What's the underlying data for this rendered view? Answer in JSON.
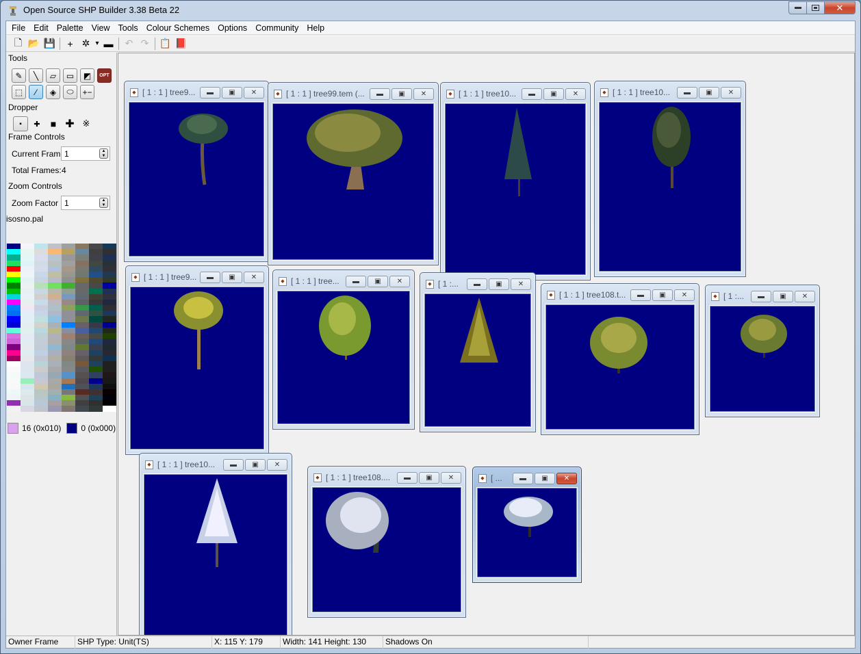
{
  "app": {
    "title": "Open Source SHP Builder 3.38 Beta 22",
    "window_buttons": [
      "minimize",
      "maximize",
      "close"
    ]
  },
  "menu": [
    "File",
    "Edit",
    "Palette",
    "View",
    "Tools",
    "Colour Schemes",
    "Options",
    "Community",
    "Help"
  ],
  "toolbar": [
    {
      "name": "new-file-icon",
      "glyph": "🗋",
      "enabled": true
    },
    {
      "name": "open-folder-icon",
      "glyph": "📂",
      "enabled": true
    },
    {
      "name": "save-icon",
      "glyph": "💾",
      "enabled": true
    },
    {
      "sep": true
    },
    {
      "name": "add-frame-icon",
      "glyph": "+",
      "enabled": true
    },
    {
      "name": "preview-icon",
      "glyph": "✲",
      "enabled": true
    },
    {
      "name": "dropdown-arrow-icon",
      "glyph": "▾",
      "enabled": true
    },
    {
      "name": "sequence-icon",
      "glyph": "▬",
      "enabled": true
    },
    {
      "sep": true
    },
    {
      "name": "undo-icon",
      "glyph": "↶",
      "enabled": false
    },
    {
      "name": "redo-icon",
      "glyph": "↷",
      "enabled": false
    },
    {
      "sep": true
    },
    {
      "name": "properties-icon",
      "glyph": "📋",
      "enabled": true
    },
    {
      "name": "help-book-icon",
      "glyph": "📕",
      "enabled": true
    }
  ],
  "left_panel": {
    "tools_label": "Tools",
    "tools": [
      {
        "name": "pencil-tool",
        "glyph": "✎",
        "active": false
      },
      {
        "name": "line-tool",
        "glyph": "╲",
        "active": false
      },
      {
        "name": "eraser-tool",
        "glyph": "▱",
        "active": false
      },
      {
        "name": "rectangle-tool",
        "glyph": "▭",
        "active": false
      },
      {
        "name": "darken-lighten-tool",
        "glyph": "◩",
        "active": false
      },
      {
        "name": "opt-tool",
        "glyph": "OPT",
        "active": false
      },
      {
        "name": "select-tool",
        "glyph": "⬚",
        "active": false
      },
      {
        "name": "dropper-tool",
        "glyph": "⁄",
        "active": true
      },
      {
        "name": "fill-tool",
        "glyph": "◈",
        "active": false
      },
      {
        "name": "ellipse-tool",
        "glyph": "⬭",
        "active": false
      },
      {
        "name": "brightness-tool",
        "glyph": "+−",
        "active": false
      }
    ],
    "dropper_label": "Dropper",
    "dropper_sizes": [
      {
        "name": "brush-size-1",
        "glyph": "▪",
        "active": true
      },
      {
        "name": "brush-size-2",
        "glyph": "✚",
        "active": false
      },
      {
        "name": "brush-size-3",
        "glyph": "■",
        "active": false
      },
      {
        "name": "brush-size-4",
        "glyph": "✚",
        "active": false
      },
      {
        "name": "brush-spray",
        "glyph": "※",
        "active": false
      }
    ],
    "frame_controls_label": "Frame Controls",
    "current_frame_label": "Current Frame",
    "current_frame_value": "1",
    "total_frames_label": "Total Frames:",
    "total_frames_value": "4",
    "zoom_controls_label": "Zoom Controls",
    "zoom_factor_label": "Zoom Factor",
    "zoom_factor_value": "1",
    "palette_name": "isosno.pal",
    "palette_columns": [
      [
        "#000080",
        "#00ffff",
        "#00b090",
        "#20e060",
        "#ff0000",
        "#ffff00",
        "#00ff00",
        "#008000",
        "#00c000",
        "#00d8d8",
        "#ff00ff",
        "#0080ff",
        "#0070f0",
        "#0000ff",
        "#0000d0",
        "#60ffd8",
        "#d870e0",
        "#d060d8",
        "#800080",
        "#ff0090",
        "#a00060",
        "#ffffff",
        "#fafafa",
        "#f4faf8",
        "#f6fafb",
        "#f8f8fa",
        "#eef8f8",
        "#f0f4f8",
        "#9030b0",
        "#f2f2f2"
      ],
      [
        "#f6f4f8",
        "#e8f6f0",
        "#e4f6f6",
        "#e0f4f8",
        "#eef2f8",
        "#eef4f8",
        "#e4f4f6",
        "#eef0f2",
        "#e8f0f4",
        "#eaf2f8",
        "#e8f0ee",
        "#f2e8f2",
        "#e4eef8",
        "#e2f0f6",
        "#e4eef0",
        "#e0f2ee",
        "#e6eaf4",
        "#e0eef4",
        "#e8eaee",
        "#dceef0",
        "#e6e8ec",
        "#e0e4ee",
        "#dce6ec",
        "#dce8f0",
        "#98f0b8",
        "#d8e4f0",
        "#dceaee",
        "#dce4e8",
        "#d8e6ea",
        "#d8d8e4"
      ],
      [
        "#c0e4ec",
        "#dcdcdc",
        "#d8dcec",
        "#d0dce4",
        "#d4dcec",
        "#c8d8e8",
        "#c8d4e0",
        "#b8e0b8",
        "#c8d8e0",
        "#d0d0d0",
        "#c8dce8",
        "#c8d0e0",
        "#c8d4e8",
        "#c0e0e0",
        "#d0d4cc",
        "#b8d8e0",
        "#c0d0d4",
        "#c4ccd8",
        "#c0ccd8",
        "#c0d0e4",
        "#c4c8d4",
        "#b8d4d8",
        "#cccccc",
        "#c0c8d8",
        "#c8c8d4",
        "#d0c8b0",
        "#b8c8c0",
        "#b8c8c8",
        "#b8c8d8",
        "#c0c4cc"
      ],
      [
        "#c0c0c8",
        "#f8b870",
        "#b8c4d0",
        "#b8c0c0",
        "#b0c0d8",
        "#c0c0a0",
        "#b8b8c8",
        "#70e060",
        "#b8b8a8",
        "#d0b090",
        "#c0b8c0",
        "#b0c0c8",
        "#b0b8c8",
        "#90c0e0",
        "#a8b0b8",
        "#b8b888",
        "#b0b0b8",
        "#b0b0b0",
        "#90b8d0",
        "#a8b0c0",
        "#b0b0a8",
        "#a8b0b8",
        "#a8a8a8",
        "#98a8b0",
        "#a8a8a8",
        "#a8a8a0",
        "#a0b0b0",
        "#88b0c0",
        "#a8a0a0",
        "#9898b0"
      ],
      [
        "#a0a0a0",
        "#b8a060",
        "#989898",
        "#a0a0a0",
        "#a89888",
        "#989890",
        "#909090",
        "#40b030",
        "#90a090",
        "#7898c0",
        "#988888",
        "#90a060",
        "#909098",
        "#909098",
        "#0080ff",
        "#8890a0",
        "#a08070",
        "#888888",
        "#808888",
        "#908080",
        "#888070",
        "#808888",
        "#888888",
        "#5890c8",
        "#a87850",
        "#2070c0",
        "#787878",
        "#88b840",
        "#889070",
        "#807870"
      ],
      [
        "#8a7860",
        "#6888a0",
        "#788078",
        "#887060",
        "#787870",
        "#707870",
        "#807040",
        "#686868",
        "#686868",
        "#606870",
        "#606068",
        "#389848",
        "#606870",
        "#707850",
        "#686068",
        "#4860a0",
        "#686058",
        "#586060",
        "#607830",
        "#686068",
        "#605858",
        "#785838",
        "#585860",
        "#585050",
        "#504850",
        "#505058",
        "#582a20",
        "#505050",
        "#404040",
        "#404850"
      ],
      [
        "#484848",
        "#404040",
        "#404048",
        "#404840",
        "#304860",
        "#20508a",
        "#504830",
        "#484848",
        "#007050",
        "#404030",
        "#383838",
        "#006050",
        "#305040",
        "#004840",
        "#383848",
        "#204870",
        "#484848",
        "#204878",
        "#384050",
        "#204060",
        "#303838",
        "#204060",
        "#205000",
        "#304060",
        "#000090",
        "#203858",
        "#403030",
        "#204058",
        "#303030",
        "#303838"
      ],
      [
        "#183858",
        "#303030",
        "#203050",
        "#283038",
        "#303038",
        "#203850",
        "#303828",
        "#0000a0",
        "#203050",
        "#303040",
        "#202840",
        "#302e30",
        "#203858",
        "#202820",
        "#000090",
        "#202818",
        "#204000",
        "#202840",
        "#202830",
        "#282830",
        "#103050",
        "#202020",
        "#202020",
        "#201818",
        "#181818",
        "#101010",
        "#080000",
        "#000008",
        "#000000",
        "#ffffff"
      ]
    ],
    "primary_color_label": "16 (0x010)",
    "primary_color": "#dca0f0",
    "secondary_color_label": "0 (0x000)",
    "secondary_color": "#000080"
  },
  "child_windows": [
    {
      "title": "[ 1 : 1 ] tree9...",
      "tree": "palm-tree",
      "active": false
    },
    {
      "title": "[ 1 : 1 ] tree99.tem (...",
      "tree": "broad-oak",
      "active": false
    },
    {
      "title": "[ 1 : 1 ] tree10...",
      "tree": "tall-pine",
      "active": false
    },
    {
      "title": "[ 1 : 1 ] tree10...",
      "tree": "dark-tree",
      "active": false
    },
    {
      "title": "[ 1 : 1 ] tree9...",
      "tree": "yellow-palm",
      "active": false
    },
    {
      "title": "[ 1 : 1 ] tree...",
      "tree": "light-green-tree",
      "active": false
    },
    {
      "title": "[ 1 :...",
      "tree": "fir-tree",
      "active": false
    },
    {
      "title": "[ 1 : 1 ] tree108.t...",
      "tree": "round-tree",
      "active": false
    },
    {
      "title": "[ 1 :...",
      "tree": "small-tree",
      "active": false
    },
    {
      "title": "[ 1 : 1 ] tree10...",
      "tree": "snow-pine",
      "active": false
    },
    {
      "title": "[ 1 : 1 ] tree108....",
      "tree": "snow-broad",
      "active": false
    },
    {
      "title": "[ ...",
      "tree": "snow-small",
      "active": true
    }
  ],
  "canvas_color": "#000080",
  "status": {
    "owner": "Owner Frame",
    "shp_type": "SHP Type: Unit(TS)",
    "coords": "X: 115 Y: 179",
    "size": "Width: 141 Height: 130",
    "shadows": "Shadows On"
  }
}
